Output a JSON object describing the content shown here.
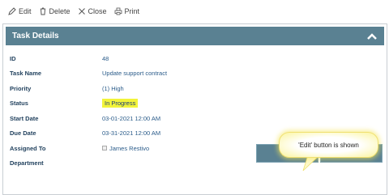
{
  "toolbar": {
    "edit_label": "Edit",
    "delete_label": "Delete",
    "close_label": "Close",
    "print_label": "Print"
  },
  "panel": {
    "title": "Task Details"
  },
  "fields": [
    {
      "label": "ID",
      "value": "48"
    },
    {
      "label": "Task Name",
      "value": "Update support contract"
    },
    {
      "label": "Priority",
      "value": "(1) High"
    },
    {
      "label": "Status",
      "value": "In Progress"
    },
    {
      "label": "Start Date",
      "value": "03-01-2021 12:00 AM"
    },
    {
      "label": "Due Date",
      "value": "03-31-2021 12:00 AM"
    },
    {
      "label": "Assigned To",
      "value": "James Restivo"
    },
    {
      "label": "Department",
      "value": ""
    }
  ],
  "buttons": {
    "edit_label": "Edit",
    "close_label": "Close"
  },
  "callout": {
    "text": "'Edit' button is shown"
  },
  "colors": {
    "header": "#5a8192",
    "status_highlight": "#f2f43a",
    "callout_glow": "#fbf59e"
  }
}
